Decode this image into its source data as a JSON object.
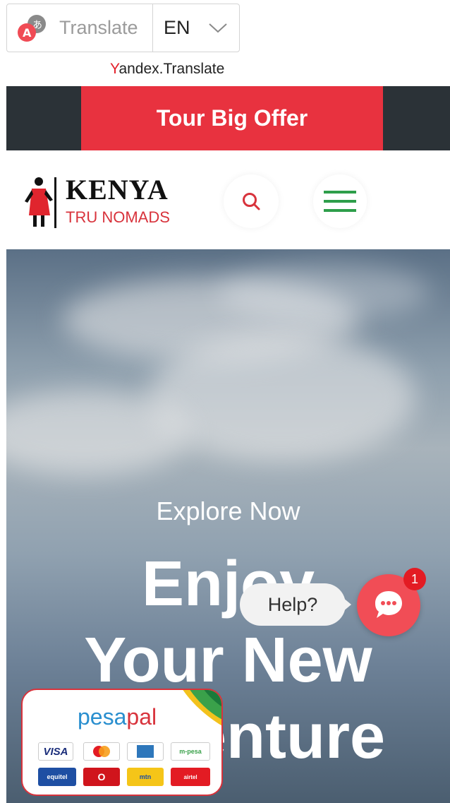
{
  "translate": {
    "label": "Translate",
    "language": "EN",
    "brand_first": "Y",
    "brand_rest": "andex.Translate"
  },
  "offer": {
    "label": "Tour Big Offer"
  },
  "logo": {
    "title": "KENYA",
    "subtitle": "TRU NOMADS"
  },
  "hero": {
    "kicker": "Explore Now",
    "title_line1": "Enjoy",
    "title_line2": "Your New",
    "title_line3": "Adventure"
  },
  "chat": {
    "help_label": "Help?",
    "badge_count": "1"
  },
  "payments": {
    "brand_pesa": "pesa",
    "brand_pal": "pal",
    "methods": [
      "VISA",
      "mastercard",
      "amex",
      "mpesa",
      "equitel",
      "vodafone",
      "mtn",
      "airtel money"
    ]
  },
  "colors": {
    "accent_red": "#e8323f",
    "dark_bar": "#2b3237",
    "menu_green": "#2e9e4a",
    "pesapal_blue": "#2a8fcf"
  }
}
